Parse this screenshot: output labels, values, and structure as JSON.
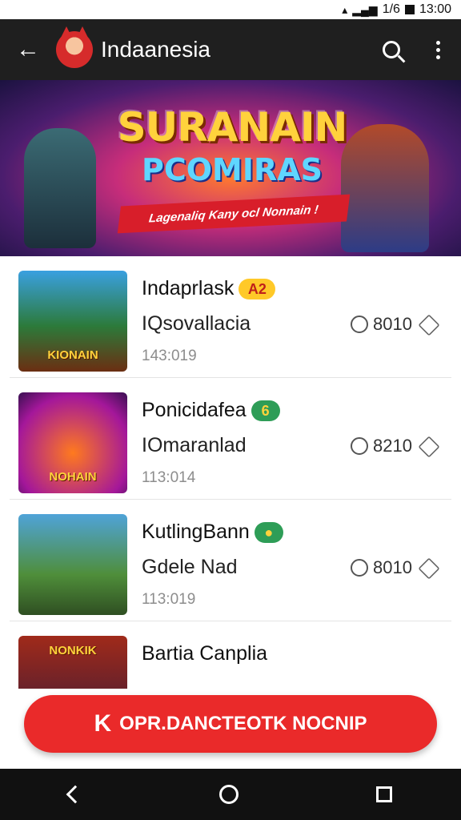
{
  "status": {
    "signal_text": "1/6",
    "time": "13:00"
  },
  "appbar": {
    "title": "Indaanesia"
  },
  "banner": {
    "headline": "SURANAIN",
    "subheadline": "PCOMIRAS",
    "tagline": "Lagenaliq Kany ocl Nonnain !"
  },
  "items": [
    {
      "name": "Indaprlask",
      "badge": "A2",
      "badge_color": "#ffc928",
      "subtitle": "IQsovallacia",
      "count": "8010",
      "time": "143:019",
      "thumb_caption": "KIONAIN"
    },
    {
      "name": "Ponicidafea",
      "badge": "6",
      "badge_color": "#2e9d57",
      "subtitle": "IOmaranlad",
      "count": "8210",
      "time": "113:014",
      "thumb_caption": "NOHAIN"
    },
    {
      "name": "KutlingBann",
      "badge": "",
      "badge_color": "#2e9d57",
      "subtitle": "Gdele Nad",
      "count": "8010",
      "time": "113:019",
      "thumb_caption": ""
    },
    {
      "name": "Bartia Canplia",
      "badge": "",
      "badge_color": "",
      "subtitle": "",
      "count": "",
      "time": "",
      "thumb_caption": "NONKIK"
    }
  ],
  "cta": {
    "label": "OPR.DANCTEOTK NOCNIP",
    "icon_letter": "K"
  },
  "icons": {
    "back": "arrow-left-icon",
    "search": "search-icon",
    "menu": "more-vert-icon",
    "count": "circle-icon",
    "share": "share-icon"
  },
  "colors": {
    "appbar": "#1f1f1f",
    "accent": "#ea2a2a",
    "navbar": "#111111"
  }
}
